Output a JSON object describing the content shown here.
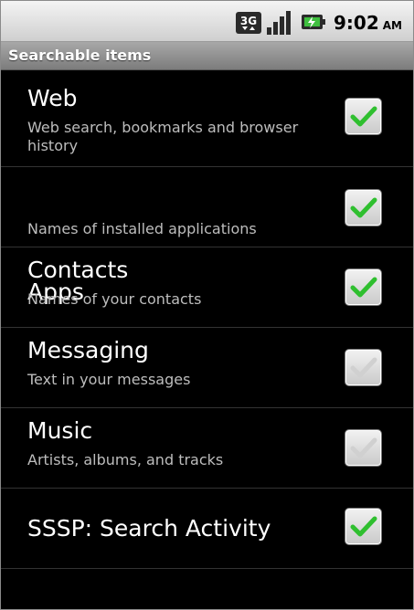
{
  "status_bar": {
    "network_badge": "3G",
    "network_icon": "3g-icon",
    "signal_icon": "signal-bars-icon",
    "battery_icon": "battery-charging-icon",
    "time": "9:02",
    "ampm": "AM"
  },
  "header": {
    "title": "Searchable items"
  },
  "items": [
    {
      "title": "Web",
      "summary": "Web search, bookmarks and browser history",
      "checked": true,
      "enabled": true
    },
    {
      "title": "Apps",
      "summary": "Names of installed applications",
      "checked": true,
      "enabled": true
    },
    {
      "title": "Contacts",
      "summary": "Names of your contacts",
      "checked": true,
      "enabled": true
    },
    {
      "title": "Messaging",
      "summary": "Text in your messages",
      "checked": true,
      "enabled": false
    },
    {
      "title": "Music",
      "summary": "Artists, albums, and tracks",
      "checked": true,
      "enabled": false
    },
    {
      "title": "SSSP: Search Activity",
      "summary": "",
      "checked": true,
      "enabled": true
    }
  ],
  "colors": {
    "background": "#000000",
    "check_enabled": "#2fbf2f",
    "check_disabled": "#d0d0d0",
    "title_text": "#ffffff",
    "summary_text": "#bdbdbd"
  }
}
